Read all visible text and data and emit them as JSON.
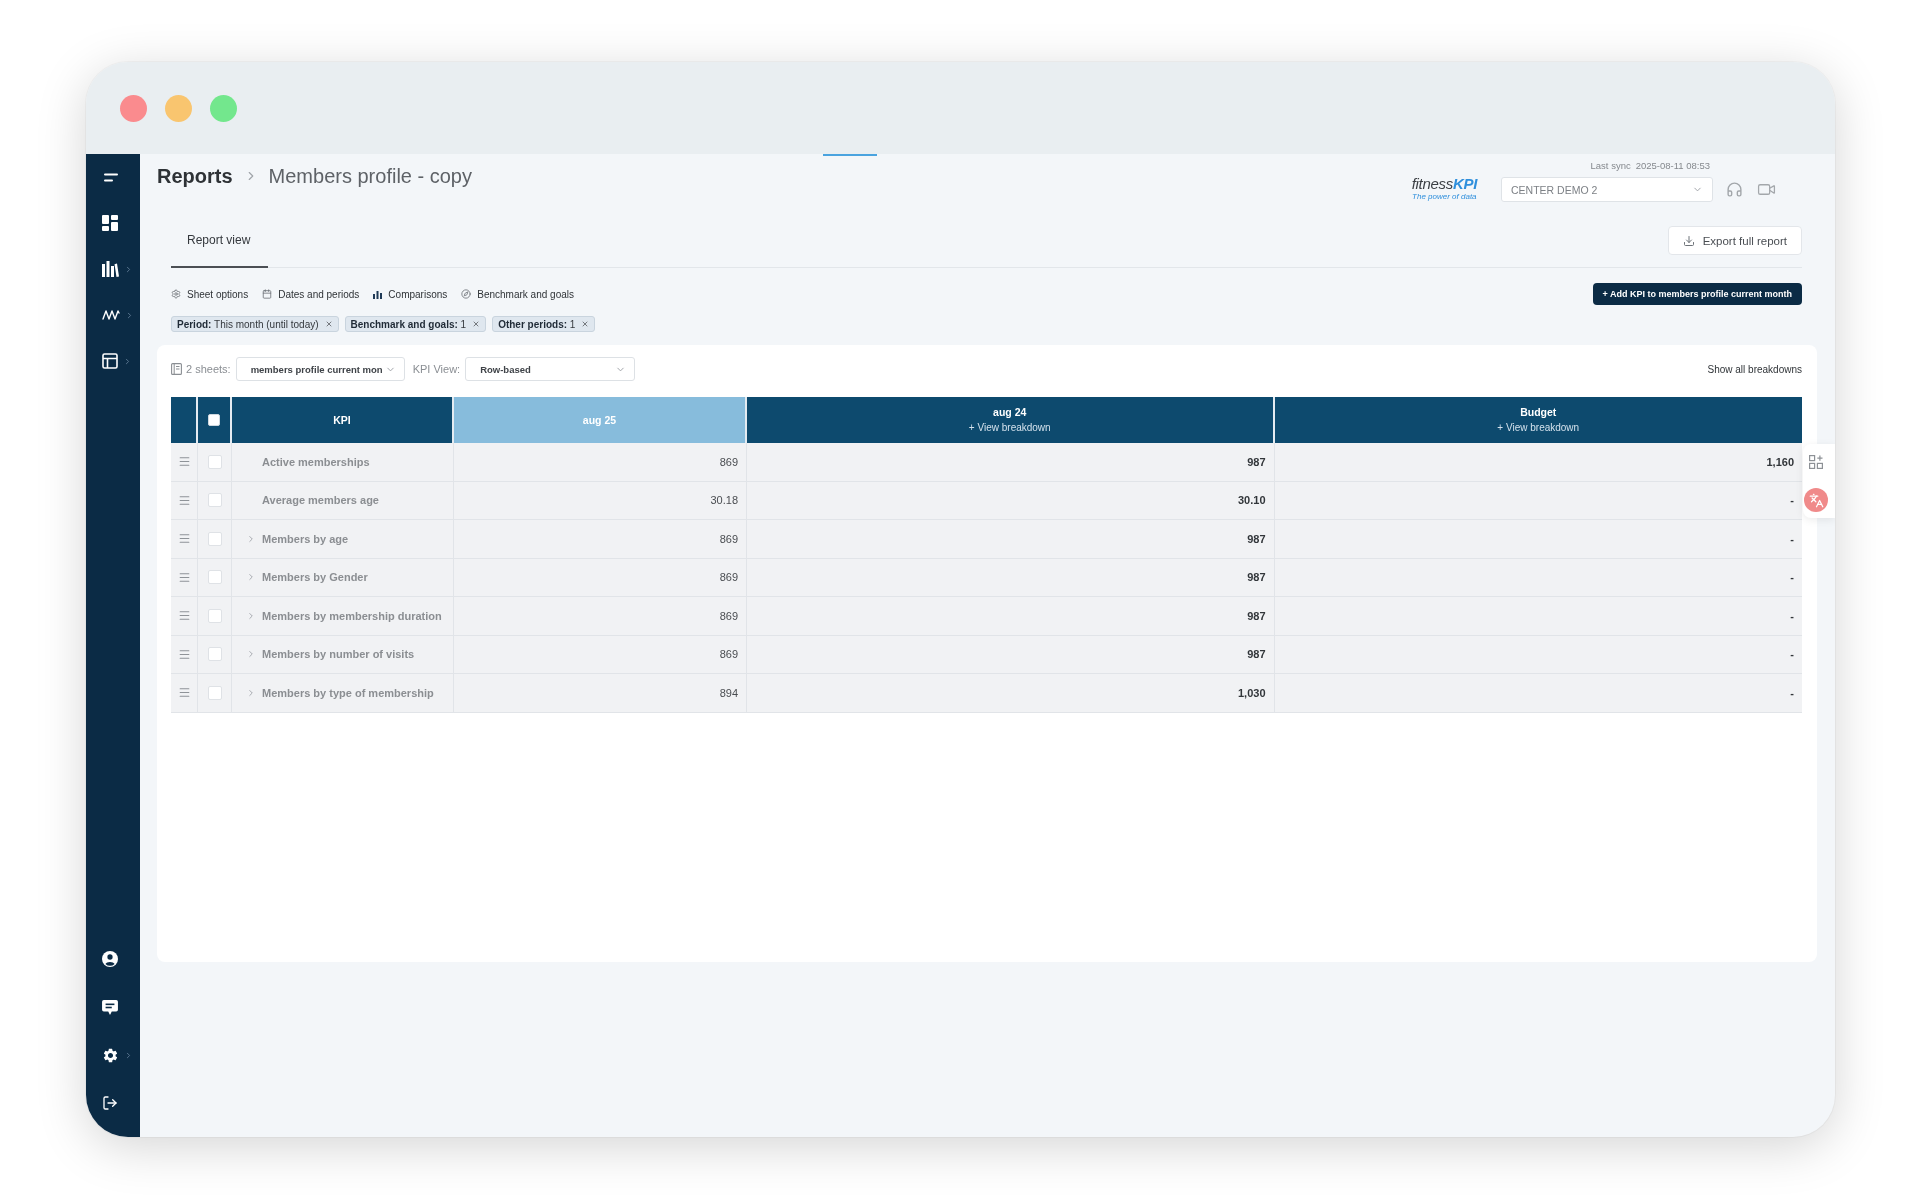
{
  "sidebar": {
    "top": [
      {
        "kind": "menu",
        "submenu": false
      },
      {
        "kind": "dashboard",
        "submenu": false
      },
      {
        "kind": "reports",
        "submenu": true
      },
      {
        "kind": "analytics",
        "submenu": true
      },
      {
        "kind": "tables",
        "submenu": true
      }
    ],
    "bottom": [
      {
        "kind": "profile",
        "submenu": false
      },
      {
        "kind": "messages",
        "submenu": false
      },
      {
        "kind": "settings",
        "submenu": true
      },
      {
        "kind": "logout",
        "submenu": false
      }
    ]
  },
  "breadcrumb": [
    {
      "label": "Reports",
      "current": false
    },
    {
      "label": "Members profile - copy",
      "current": true
    }
  ],
  "header": {
    "logo": {
      "word": "fitness",
      "accent": "KPI",
      "tagline": "The power of data"
    },
    "sync_label": "Last sync",
    "sync_time": "2025-08-11 08:53",
    "center_select": "CENTER DEMO 2"
  },
  "tabs": [
    {
      "label": "Report view",
      "selected": true
    }
  ],
  "export_button": "Export full report",
  "options": [
    {
      "kind": "sheet",
      "label": "Sheet options"
    },
    {
      "kind": "dates",
      "label": "Dates and periods"
    },
    {
      "kind": "comparisons",
      "label": "Comparisons"
    },
    {
      "kind": "benchmark",
      "label": "Benchmark and goals"
    }
  ],
  "add_kpi_button": "+ Add KPI to members profile current month",
  "filters": [
    {
      "text": "**Period:** This month (until today)"
    },
    {
      "text": "**Benchmark and goals:** 1"
    },
    {
      "text": "**Other periods:** 1"
    }
  ],
  "sheets": {
    "count_label": "2 sheets:",
    "sheet_select": "members profile current mon",
    "view_label": "KPI View:",
    "view_select": "Row-based",
    "show_all": "Show all breakdowns"
  },
  "table": {
    "select_all": {
      "checked": false
    },
    "columns": [
      {
        "label": "KPI",
        "current": false
      },
      {
        "label": "aug 25",
        "current": true
      },
      {
        "label": "aug 24",
        "current": false,
        "link": "+ View breakdown"
      },
      {
        "label": "Budget",
        "current": false,
        "link": "+ View breakdown"
      }
    ],
    "rows": [
      {
        "name": "Active memberships",
        "expandable": false,
        "expanded": false,
        "checked": false,
        "values": [
          "869",
          "987",
          "1,160"
        ]
      },
      {
        "name": "Average members age",
        "expandable": false,
        "expanded": false,
        "checked": false,
        "values": [
          "30.18",
          "30.10",
          "-"
        ]
      },
      {
        "name": "Members by age",
        "expandable": true,
        "expanded": false,
        "checked": false,
        "values": [
          "869",
          "987",
          "-"
        ]
      },
      {
        "name": "Members by Gender",
        "expandable": true,
        "expanded": false,
        "checked": false,
        "values": [
          "869",
          "987",
          "-"
        ]
      },
      {
        "name": "Members by membership duration",
        "expandable": true,
        "expanded": false,
        "checked": false,
        "values": [
          "869",
          "987",
          "-"
        ]
      },
      {
        "name": "Members by number of visits",
        "expandable": true,
        "expanded": false,
        "checked": false,
        "values": [
          "869",
          "987",
          "-"
        ]
      },
      {
        "name": "Members by type of membership",
        "expandable": true,
        "expanded": false,
        "checked": false,
        "values": [
          "894",
          "1,030",
          "-"
        ]
      }
    ]
  }
}
